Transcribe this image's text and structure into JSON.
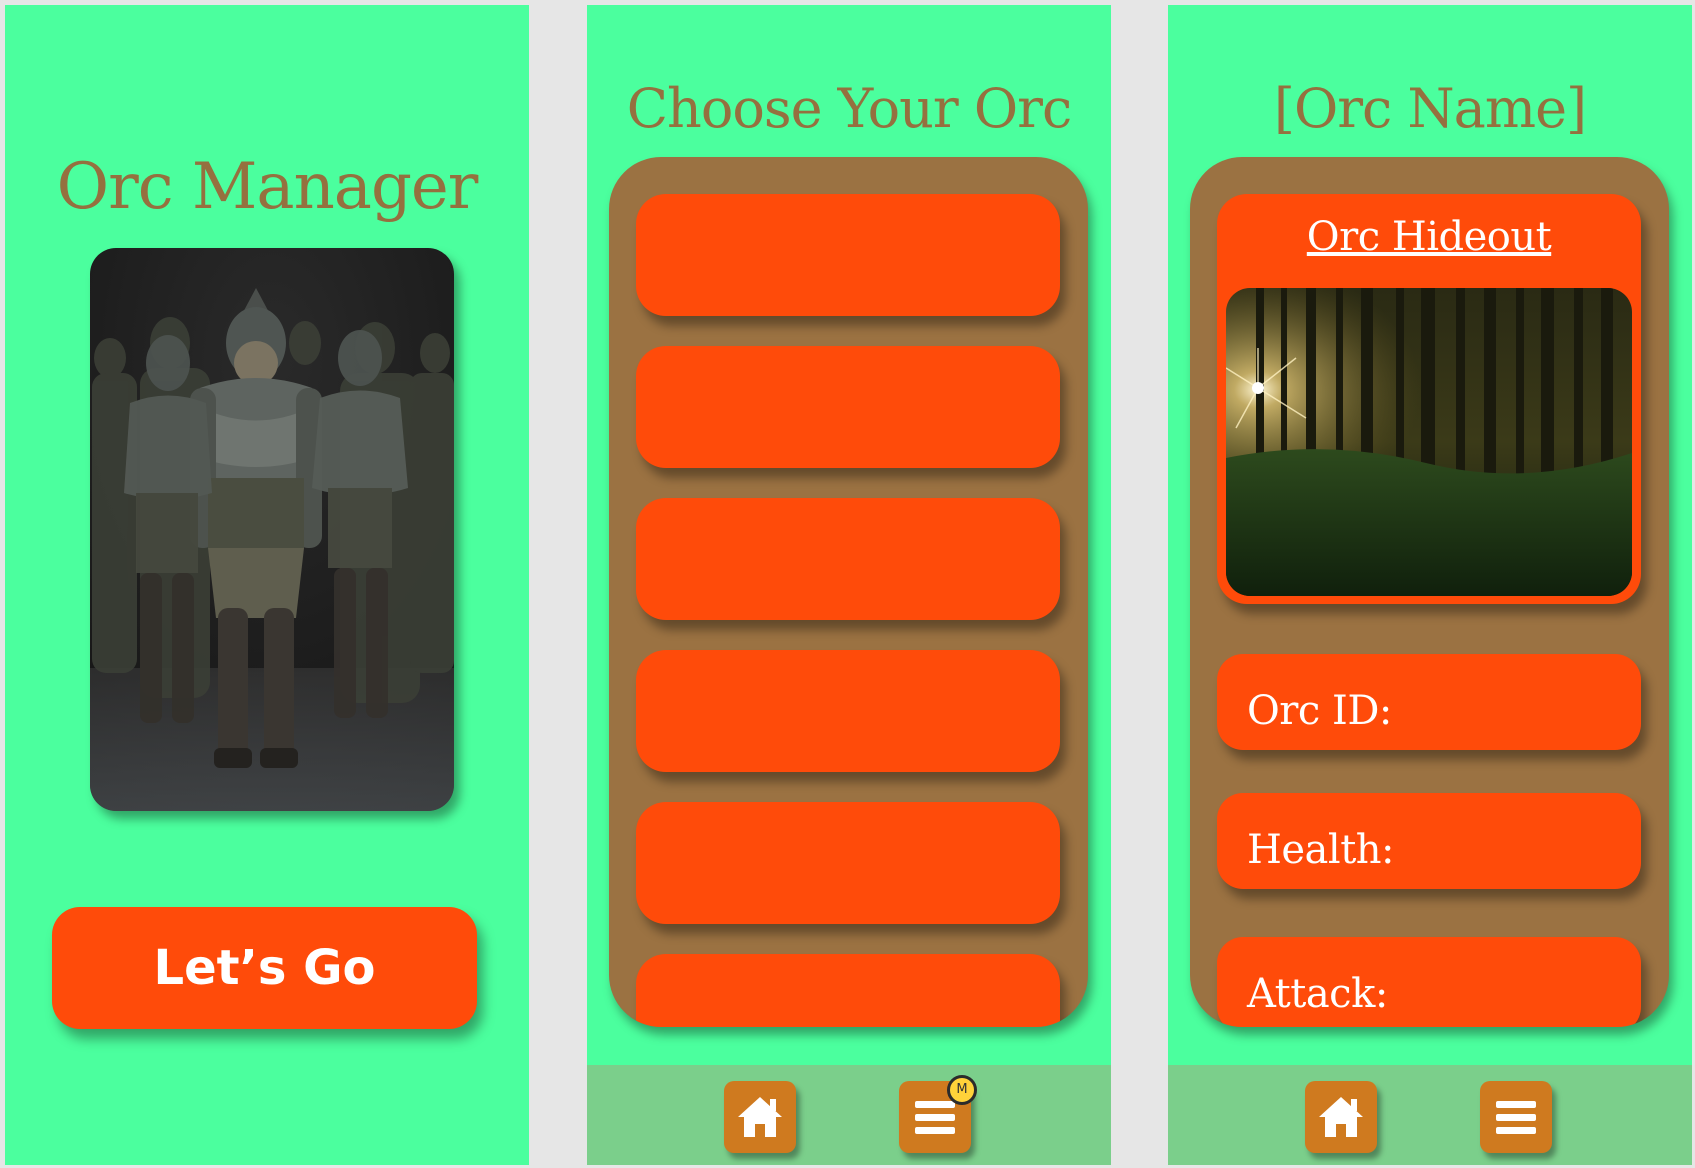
{
  "screen1": {
    "title": "Orc Manager",
    "image": "orc-army-image",
    "button_label": "Let’s Go"
  },
  "screen2": {
    "title": "Choose Your Orc",
    "slots": [
      "",
      "",
      "",
      "",
      "",
      ""
    ],
    "nav": {
      "home_icon": "home-icon",
      "menu_icon": "menu-icon",
      "badge": "M"
    }
  },
  "screen3": {
    "title": "[Orc Name]",
    "hideout_link": "Orc Hideout",
    "image": "forest-hideout-image",
    "stats": [
      {
        "label": "Orc ID:"
      },
      {
        "label": "Health:"
      },
      {
        "label": "Attack:"
      }
    ],
    "nav": {
      "home_icon": "home-icon",
      "menu_icon": "menu-icon"
    }
  },
  "colors": {
    "background": "#4bff9e",
    "accent": "#ff4b0a",
    "panel": "#9b7242",
    "title": "#95703f",
    "nav_bar": "#7bcf8b",
    "nav_button": "#cf7a1f"
  }
}
